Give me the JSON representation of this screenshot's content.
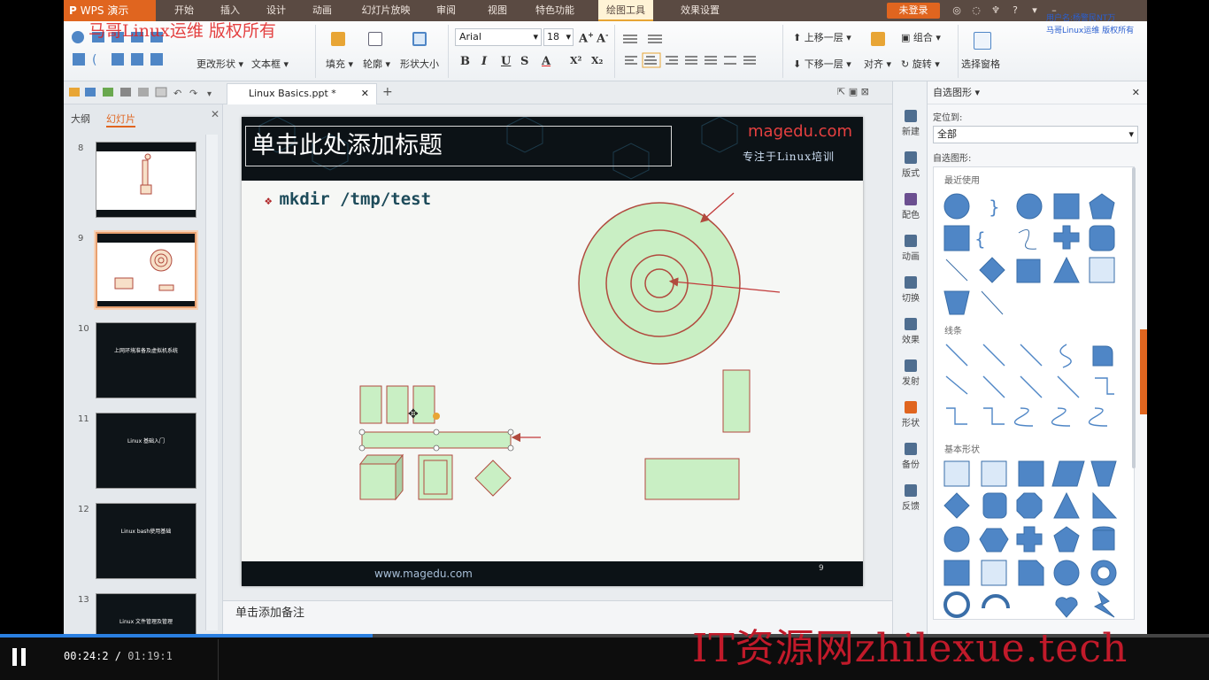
{
  "app": {
    "name": "WPS 演示",
    "login": "未登录",
    "menu": [
      {
        "label": "开始",
        "active": false
      },
      {
        "label": "插入",
        "active": false
      },
      {
        "label": "设计",
        "active": false
      },
      {
        "label": "动画",
        "active": false
      },
      {
        "label": "幻灯片放映",
        "active": false
      },
      {
        "label": "审阅",
        "active": false
      },
      {
        "label": "视图",
        "active": false
      },
      {
        "label": "特色功能",
        "active": false
      },
      {
        "label": "绘图工具",
        "active": true
      },
      {
        "label": "效果设置",
        "active": false
      }
    ]
  },
  "watermark": {
    "top_left": "马哥Linux运维 版权所有",
    "top_right_1": "用户名:杨警民NT万",
    "top_right_2": "马哥Linux运维 版权所有",
    "site": "IT资源网zhilexue.tech"
  },
  "ribbon": {
    "change_shape": "更改形状",
    "text_box": "文本框",
    "fill": "填充",
    "outline": "轮廓",
    "shape_size": "形状大小",
    "font": "Arial",
    "font_size": "18",
    "bold": "B",
    "italic": "I",
    "underline": "U",
    "strike": "S",
    "font_color": "A",
    "superscript": "X²",
    "subscript": "X₂",
    "bring_forward": "上移一层",
    "send_backward": "下移一层",
    "group": "组合",
    "align": "对齐",
    "rotate": "旋转",
    "selection_pane": "选择窗格"
  },
  "doc_tab": {
    "name": "Linux Basics.ppt *"
  },
  "left_panel": {
    "tabs": [
      "大纲",
      "幻灯片"
    ],
    "active_tab": "幻灯片",
    "slides": [
      {
        "num": "8",
        "title": "",
        "dark": false,
        "selected": false
      },
      {
        "num": "9",
        "title": "",
        "dark": false,
        "selected": true
      },
      {
        "num": "10",
        "title": "上网环境准备及虚拟机系统",
        "dark": true,
        "selected": false
      },
      {
        "num": "11",
        "title": "Linux 基础入门",
        "dark": true,
        "selected": false
      },
      {
        "num": "12",
        "title": "Linux bash使用基础",
        "dark": true,
        "selected": false
      },
      {
        "num": "13",
        "title": "Linux 文件管理及管理",
        "dark": true,
        "selected": false
      }
    ]
  },
  "slide": {
    "title_placeholder": "单击此处添加标题",
    "brand": "magedu.com",
    "brand_tagline": "专注于Linux培训",
    "bullet_mark": "❖",
    "bullet": "mkdir /tmp/test",
    "footer_url": "www.magedu.com",
    "page_num": "9"
  },
  "notes": "单击添加备注",
  "vtoolbar": [
    "新建",
    "版式",
    "配色",
    "动画",
    "切换",
    "效果",
    "发射",
    "形状",
    "备份",
    "反馈"
  ],
  "shape_panel": {
    "title": "自选图形",
    "position_label": "定位到:",
    "position_value": "全部",
    "gallery_label": "自选图形:",
    "recent": "最近使用",
    "lines": "线条",
    "basic": "基本形状"
  },
  "player": {
    "current": "00:24:2",
    "total": "01:19:1",
    "progress": 0.308
  },
  "colors": {
    "shape_fill": "#c9efc4",
    "shape_stroke": "#b14a3e",
    "accent": "#e0651f",
    "gallery_blue": "#4f86c6"
  }
}
